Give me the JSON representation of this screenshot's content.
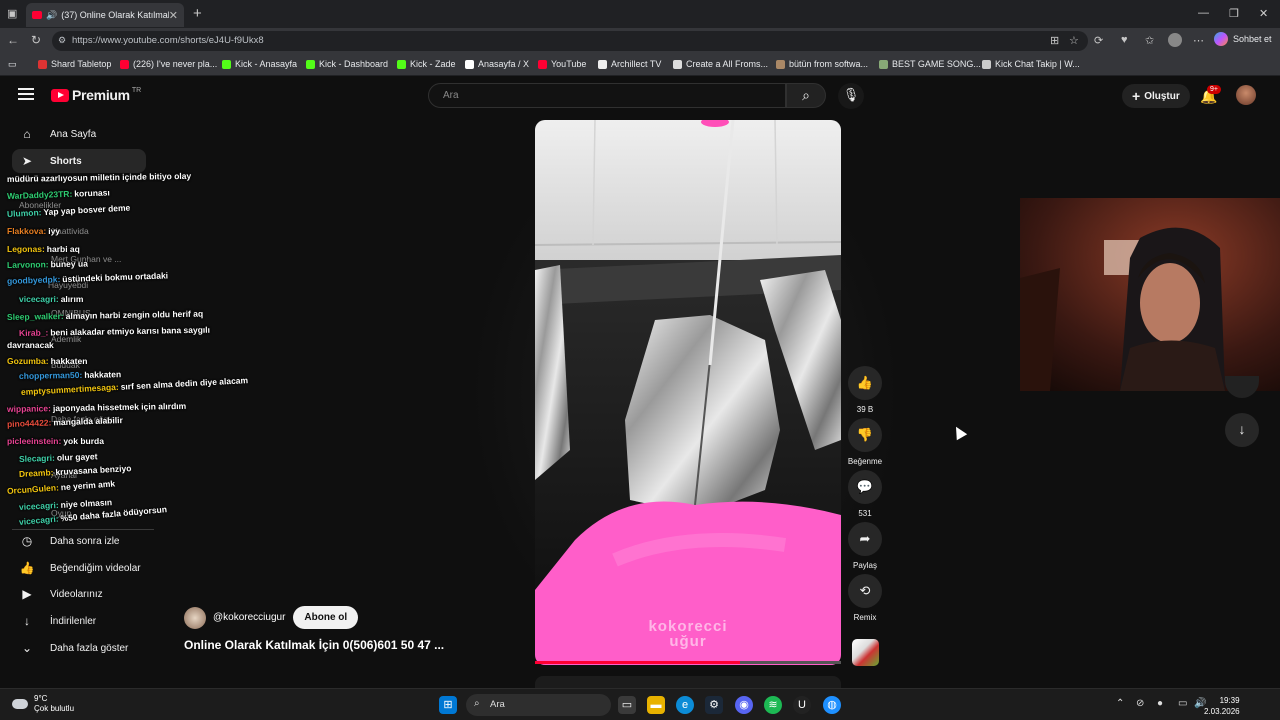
{
  "browser": {
    "tab_title": "(37) Online Olarak Katılmak İç",
    "url": "https://www.youtube.com/shorts/eJ4U-f9Ukx8",
    "sign_in_label": "Sohbet et",
    "bookmarks": [
      {
        "label": "Shard Tabletop",
        "color": "#d33"
      },
      {
        "label": "(226) I've never pla...",
        "color": "#ff0033"
      },
      {
        "label": "Kick - Anasayfa",
        "color": "#53fc18"
      },
      {
        "label": "Kick - Dashboard",
        "color": "#53fc18"
      },
      {
        "label": "Kick - Zade",
        "color": "#53fc18"
      },
      {
        "label": "Anasayfa / X",
        "color": "#ffffff"
      },
      {
        "label": "YouTube",
        "color": "#ff0033"
      },
      {
        "label": "Archillect TV",
        "color": "#eeeeee"
      },
      {
        "label": "Create a All Froms...",
        "color": "#dddddd"
      },
      {
        "label": "bütün from softwa...",
        "color": "#a86"
      },
      {
        "label": "BEST GAME SONG...",
        "color": "#8a7"
      },
      {
        "label": "Kick Chat Takip | W...",
        "color": "#ccc"
      }
    ]
  },
  "youtube": {
    "logo": "Premium",
    "logo_region": "TR",
    "search_placeholder": "Ara",
    "create_label": "Oluştur",
    "notif_count": "9+",
    "sidebar_top": [
      {
        "label": "Ana Sayfa",
        "icon": "home-icon"
      },
      {
        "label": "Shorts",
        "icon": "shorts-icon"
      }
    ],
    "sidebar_bottom": [
      {
        "label": "Daha sonra izle",
        "icon": "clock-icon"
      },
      {
        "label": "Beğendiğim videolar",
        "icon": "thumbs-up-icon"
      },
      {
        "label": "Videolarınız",
        "icon": "video-icon"
      },
      {
        "label": "İndirilenler",
        "icon": "download-icon"
      },
      {
        "label": "Daha fazla göster",
        "icon": "chevron-down-icon"
      }
    ],
    "short": {
      "channel": "@kokorecciugur",
      "subscribe_label": "Abone ol",
      "title": "Online Olarak Katılmak İçin 0(506)601 50 47 ...",
      "watermark_line1": "kokorecci",
      "watermark_line2": "uğur",
      "progress": 0.67,
      "likes": "39 B",
      "dislike_label": "Beğenme",
      "comments": "531",
      "share_label": "Paylaş",
      "remix_label": "Remix"
    }
  },
  "chat": {
    "lines": [
      {
        "user": "",
        "text": "müdürü azarlıyosun milletin içinde bitiyo olay",
        "color": "#ffffff"
      },
      {
        "user": "WarDaddy23TR:",
        "text": "korunası",
        "color": "#2ecc71"
      },
      {
        "user": "Ulumon:",
        "text": "Yap yap bosver deme",
        "color": "#3fd0a8"
      },
      {
        "user": "Flakkova:",
        "text": "iyy",
        "color": "#e67e22"
      },
      {
        "user": "Legonas:",
        "text": "harbi aq",
        "color": "#f1c40f"
      },
      {
        "user": "Larvonon:",
        "text": "buney ua",
        "color": "#2ecc71"
      },
      {
        "user": "goodbyedpk:",
        "text": "üstündeki bokmu ortadaki",
        "color": "#3498db"
      },
      {
        "user": "vicecagri:",
        "text": "alırım",
        "color": "#3fd0a8"
      },
      {
        "user": "Sleep_walker:",
        "text": "almayın harbi zengin oldu herif aq",
        "color": "#2ecc71"
      },
      {
        "user": "Kirab_:",
        "text": "beni alakadar etmiyo karısı bana saygılı",
        "color": "#e84393"
      },
      {
        "user": "",
        "text": "davranacak",
        "color": "#ffffff"
      },
      {
        "user": "Gozumba:",
        "text": "hakkaten",
        "color": "#f1c40f"
      },
      {
        "user": "chopperman50:",
        "text": "hakkaten",
        "color": "#3498db"
      },
      {
        "user": "emptysummertimesaga:",
        "text": "sırf sen alma dedin diye alacam",
        "color": "#f1c40f"
      },
      {
        "user": "wippanice:",
        "text": "japonyada hissetmek için alırdım",
        "color": "#e84393"
      },
      {
        "user": "pino44422:",
        "text": "mangalda alabilir",
        "color": "#e74c3c"
      },
      {
        "user": "picleeinstein:",
        "text": "yok burda",
        "color": "#e84393"
      },
      {
        "user": "Slecagri:",
        "text": "olur gayet",
        "color": "#3fd0a8"
      },
      {
        "user": "Dreamb:",
        "text": "kruvasana benziyo",
        "color": "#f1c40f"
      },
      {
        "user": "OrcunGulen:",
        "text": "ne yerim amk",
        "color": "#f1c40f"
      },
      {
        "user": "vicecagri:",
        "text": "niye olmasın",
        "color": "#3fd0a8"
      },
      {
        "user": "vicecagri:",
        "text": "%50 daha fazla ödüyorsun",
        "color": "#3fd0a8"
      }
    ],
    "ghost": [
      "Abonelikler",
      "Yaattivida",
      "Mert Gunhan ve ...",
      "Hayuyebdi",
      "OMNIBUS",
      "Ademlik",
      "Buduak",
      "Daha fazla göster",
      "Oyun",
      "Ayarlar"
    ]
  },
  "taskbar": {
    "temp": "9°C",
    "weather": "Çok bulutlu",
    "search_label": "Ara",
    "time": "19:39",
    "date": "2.03.2026"
  }
}
